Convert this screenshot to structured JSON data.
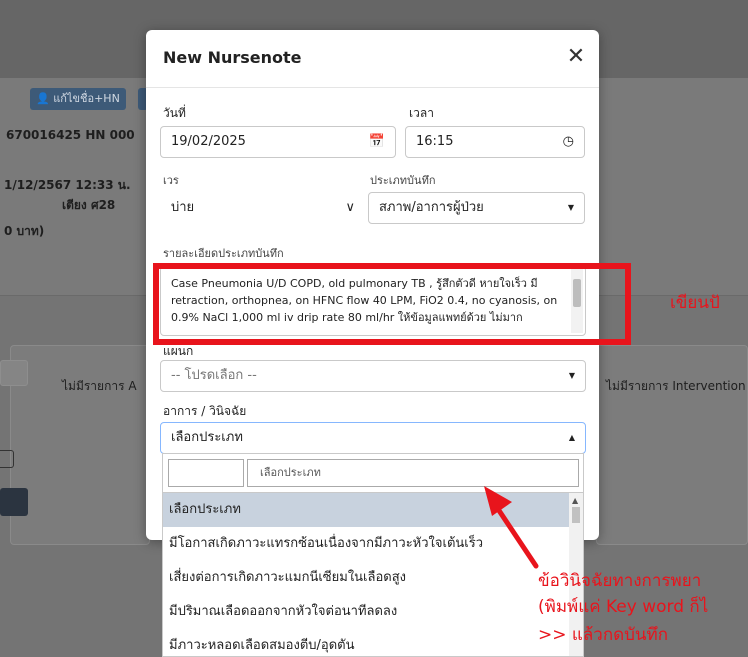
{
  "background": {
    "edit_button_label": "แก้ไขชื่อ+HN",
    "patient_line": "670016425  HN 000",
    "admit_line": "1/12/2567 12:33 น.",
    "bed_line": "เตียง ศ28",
    "amount_line": "0 บาท)",
    "no_items_a": "ไม่มีรายการ A",
    "no_items_intervention": "ไม่มีรายการ Intervention"
  },
  "modal": {
    "title": "New Nursenote",
    "close_icon": "close-icon",
    "date_label": "วันที่",
    "date_value": "19/02/2025",
    "time_label": "เวลา",
    "time_value": "16:15",
    "shift_label": "เวร",
    "shift_value": "บ่าย",
    "record_type_label": "ประเภทบันทึก",
    "record_type_value": "สภาพ/อาการผู้ป่วย",
    "detail_label": "รายละเอียดประเภทบันทึก",
    "detail_text": "Case Pneumonia U/D COPD, old pulmonary TB , รู้สึกตัวดี หายใจเร็ว มี retraction, orthopnea, on HFNC flow 40 LPM, FiO2 0.4, no cyanosis, on 0.9% NaCl 1,000 ml iv drip rate 80 ml/hr ให้ข้อมูลแพทย์ด้วย ไม่มาก",
    "plan_label": "แผนก",
    "plan_placeholder": "-- โปรดเลือก --",
    "diagnosis_label": "อาการ / วินิจฉัย",
    "diagnosis_value": "เลือกประเภท",
    "search_placeholder": "เลือกประเภท",
    "options": [
      "เลือกประเภท",
      "มีโอกาสเกิดภาวะแทรกซ้อนเนื่องจากมีภาวะหัวใจเต้นเร็ว",
      "เสี่ยงต่อการเกิดภาวะแมกนีเซียมในเลือดสูง",
      "มีปริมาณเลือดออกจากหัวใจต่อนาทีลดลง",
      "มีภาวะหลอดเลือดสมองตีบ/อุดตัน"
    ]
  },
  "annotations": {
    "write_note": "เขียนปั",
    "line1": "ข้อวินิจฉัยทางการพยา",
    "line2": "(พิมพ์แค่ Key word ก็ไ",
    "line3": ">> แล้วกดบันทึก",
    "color": "#e8141c"
  }
}
